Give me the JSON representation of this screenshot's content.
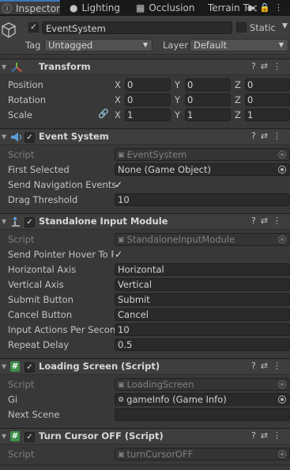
{
  "tabs": [
    {
      "label": "Inspector",
      "icon": "info-icon"
    },
    {
      "label": "Lighting",
      "icon": "lightbulb-icon"
    },
    {
      "label": "Occlusion",
      "icon": "occlusion-icon"
    },
    {
      "label": "Terrain Toc",
      "icon": "terrain-icon"
    }
  ],
  "header": {
    "name": "EventSystem",
    "active": true,
    "static_label": "Static",
    "static": false,
    "tag_label": "Tag",
    "tag_value": "Untagged",
    "layer_label": "Layer",
    "layer_value": "Default"
  },
  "transform": {
    "title": "Transform",
    "rows": [
      {
        "label": "Position",
        "x": "0",
        "y": "0",
        "z": "0"
      },
      {
        "label": "Rotation",
        "x": "0",
        "y": "0",
        "z": "0"
      },
      {
        "label": "Scale",
        "x": "1",
        "y": "1",
        "z": "1"
      }
    ],
    "axis_x": "X",
    "axis_y": "Y",
    "axis_z": "Z"
  },
  "event_system": {
    "title": "Event System",
    "script_label": "Script",
    "script_value": "EventSystem",
    "first_selected_label": "First Selected",
    "first_selected_value": "None (Game Object)",
    "send_nav_label": "Send Navigation Events",
    "send_nav_checked": true,
    "drag_threshold_label": "Drag Threshold",
    "drag_threshold_value": "10"
  },
  "standalone_input": {
    "title": "Standalone Input Module",
    "script_label": "Script",
    "script_value": "StandaloneInputModule",
    "send_pointer_label": "Send Pointer Hover To Pa",
    "send_pointer_checked": true,
    "horizontal_label": "Horizontal Axis",
    "horizontal_value": "Horizontal",
    "vertical_label": "Vertical Axis",
    "vertical_value": "Vertical",
    "submit_label": "Submit Button",
    "submit_value": "Submit",
    "cancel_label": "Cancel Button",
    "cancel_value": "Cancel",
    "actions_label": "Input Actions Per Second",
    "actions_value": "10",
    "repeat_label": "Repeat Delay",
    "repeat_value": "0.5"
  },
  "loading_screen": {
    "title": "Loading Screen (Script)",
    "script_label": "Script",
    "script_value": "LoadingScreen",
    "gi_label": "Gi",
    "gi_value": "gameInfo (Game Info)",
    "next_scene_label": "Next Scene",
    "next_scene_value": ""
  },
  "turn_cursor": {
    "title": "Turn Cursor OFF (Script)",
    "script_label": "Script",
    "script_value": "turnCursorOFF"
  },
  "colors": {
    "accent": "#3a79bb",
    "background": "#383838",
    "header": "#3e3e3e",
    "field": "#2a2a2a"
  }
}
